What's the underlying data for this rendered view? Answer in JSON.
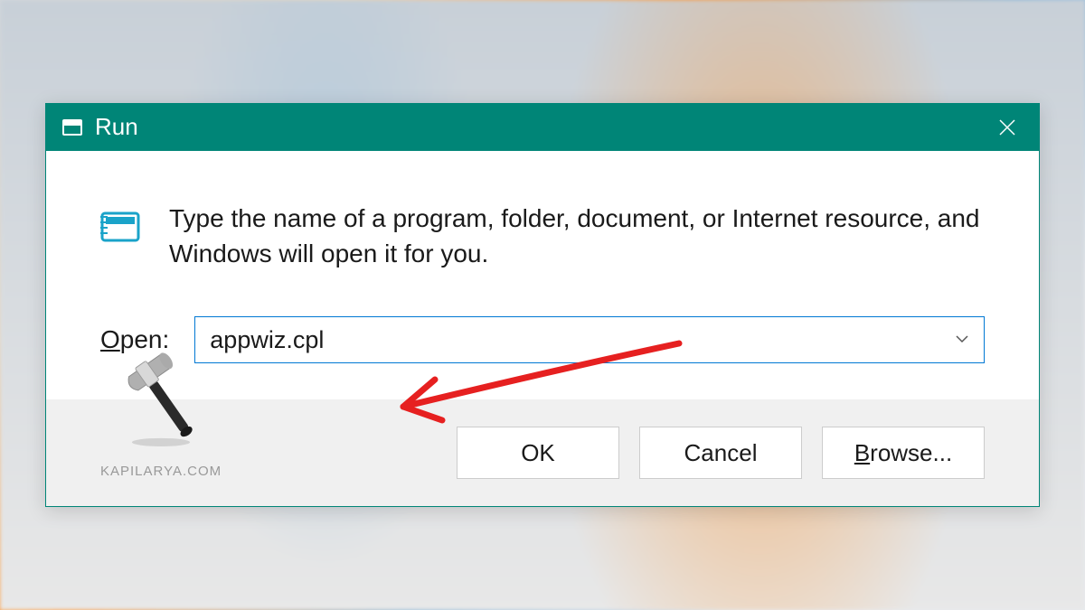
{
  "dialog": {
    "title": "Run",
    "description": "Type the name of a program, folder, document, or Internet resource, and Windows will open it for you.",
    "open_label_prefix": "O",
    "open_label_rest": "pen:",
    "open_value": "appwiz.cpl",
    "buttons": {
      "ok": "OK",
      "cancel": "Cancel",
      "browse_prefix": "B",
      "browse_rest": "rowse..."
    }
  },
  "watermark": {
    "text": "KAPILARYA.COM"
  }
}
